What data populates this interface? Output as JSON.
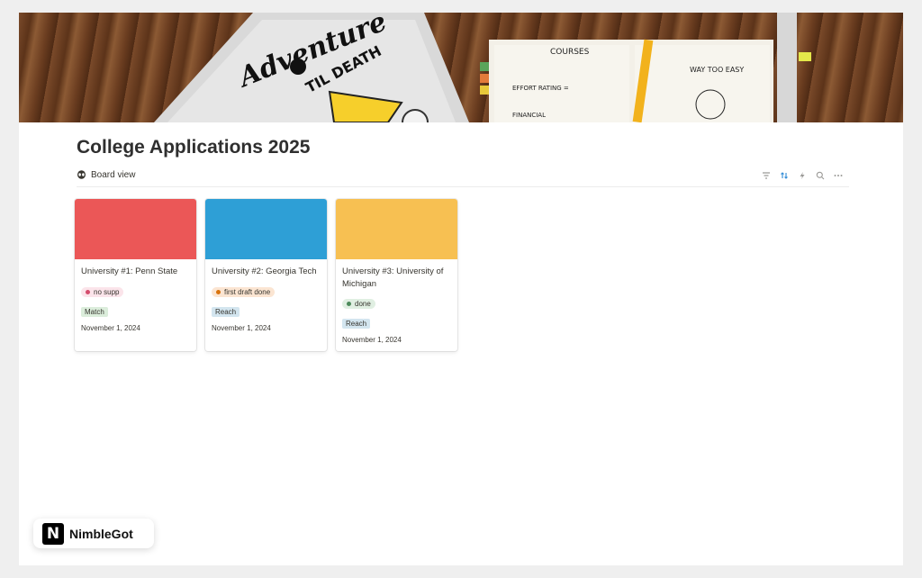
{
  "page": {
    "title": "College Applications 2025",
    "view_label": "Board view",
    "view_icon": "alien-icon",
    "toolbar_icons": [
      "filter-icon",
      "sort-icon",
      "lightning-icon",
      "search-icon",
      "more-icon"
    ]
  },
  "cover": {
    "sticker_text_1": "Adventure",
    "sticker_text_2": "TIL DEATH",
    "notebook_heading": "COURSES",
    "notebook_line_1": "EFFORT RATING =",
    "notebook_line_2": "WAY TOO EASY",
    "notebook_line_3": "FINANCIAL"
  },
  "cards": [
    {
      "title": "University #1: Penn State",
      "status": "no supp",
      "status_color": "#d44c6c",
      "status_bg": "#fbe4ea",
      "category": "Match",
      "category_bg": "#dbeddb",
      "date": "November 1, 2024",
      "cover_color": "#eb5757"
    },
    {
      "title": "University #2: Georgia Tech",
      "status": "first draft done",
      "status_color": "#d9730d",
      "status_bg": "#fbe5d2",
      "category": "Reach",
      "category_bg": "#d3e5ef",
      "date": "November 1, 2024",
      "cover_color": "#2e9fd6"
    },
    {
      "title": "University #3: University of Michigan",
      "status": "done",
      "status_color": "#4d8a5b",
      "status_bg": "#e0efe2",
      "category": "Reach",
      "category_bg": "#d3e5ef",
      "date": "November 1, 2024",
      "cover_color": "#f7c052"
    }
  ],
  "badge": {
    "logo_letter": "N",
    "label": "NimbleGot"
  }
}
